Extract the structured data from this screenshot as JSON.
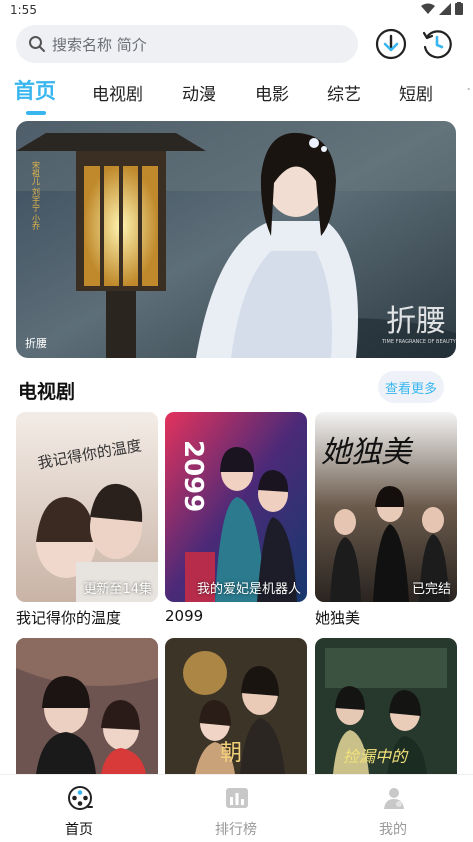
{
  "status": {
    "time": "1:55"
  },
  "search": {
    "placeholder": "搜索名称 简介"
  },
  "tabs": [
    {
      "label": "首页",
      "active": true
    },
    {
      "label": "电视剧"
    },
    {
      "label": "动漫"
    },
    {
      "label": "电影"
    },
    {
      "label": "综艺"
    },
    {
      "label": "短剧"
    }
  ],
  "banner": {
    "caption": "折腰",
    "overlay_text": "折腰",
    "small_text": "TIME FRAGRANCE OF BEAUTY",
    "side_text": "宋祖儿 刘宇宁 小乔"
  },
  "section": {
    "title": "电视剧",
    "more": "查看更多"
  },
  "cards": [
    {
      "title": "我记得你的温度",
      "badge": "更新至14集",
      "poster_text": "我记得你的温度"
    },
    {
      "title": "2099",
      "badge": "我的爱妃是机器人",
      "poster_text": "2099"
    },
    {
      "title": "她独美",
      "badge": "已完结",
      "poster_text": "她独美"
    }
  ],
  "cards_row2": [
    {
      "poster_text": ""
    },
    {
      "poster_text": "朝"
    },
    {
      "poster_text": "捡漏中的"
    }
  ],
  "nav": [
    {
      "label": "首页",
      "icon": "film-reel-icon",
      "active": true
    },
    {
      "label": "排行榜",
      "icon": "chart-icon"
    },
    {
      "label": "我的",
      "icon": "profile-icon"
    }
  ],
  "colors": {
    "accent": "#39b6ef",
    "search_bg": "#eef0f3"
  }
}
